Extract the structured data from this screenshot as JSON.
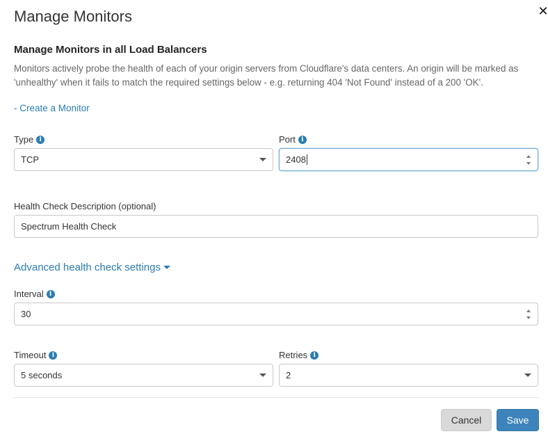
{
  "modal": {
    "title": "Manage Monitors",
    "close_glyph": "✕"
  },
  "section": {
    "heading": "Manage Monitors in all Load Balancers",
    "description": "Monitors actively probe the health of each of your origin servers from Cloudflare's data centers. An origin will be marked as 'unhealthy' when it fails to match the required settings below - e.g. returning 404 'Not Found' instead of a 200 'OK'.",
    "create_link": "- Create a Monitor"
  },
  "fields": {
    "type": {
      "label": "Type",
      "value": "TCP"
    },
    "port": {
      "label": "Port",
      "value": "2408"
    },
    "description": {
      "label": "Health Check Description (optional)",
      "value": "Spectrum Health Check"
    },
    "interval": {
      "label": "Interval",
      "value": "30"
    },
    "timeout": {
      "label": "Timeout",
      "value": "5 seconds"
    },
    "retries": {
      "label": "Retries",
      "value": "2"
    }
  },
  "advanced": {
    "label": "Advanced health check settings"
  },
  "info_glyph": "i",
  "actions": {
    "cancel": "Cancel",
    "save": "Save"
  },
  "colors": {
    "link": "#2c7cb0",
    "primary_button": "#3c84bb",
    "secondary_button": "#d9d9d9"
  }
}
